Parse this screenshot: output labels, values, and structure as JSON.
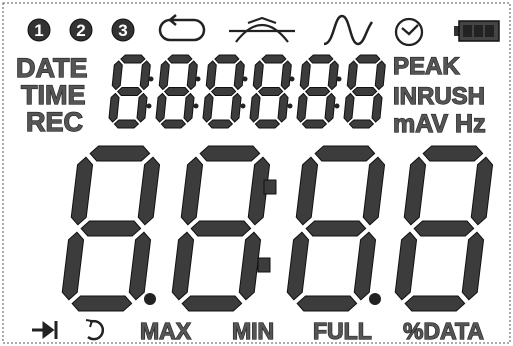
{
  "indicators": {
    "step1": "1",
    "step2": "2",
    "step3": "3",
    "date": "DATE",
    "time": "TIME",
    "rec": "REC",
    "peak": "PEAK",
    "inrush": "INRUSH",
    "units": "mAV Hz",
    "max": "MAX",
    "min": "MIN",
    "full": "FULL",
    "pct_data": "%DATA"
  },
  "icons": [
    "loop-icon",
    "peak-wave-icon",
    "sine-wave-icon",
    "clock-icon",
    "battery-icon",
    "arrow-to-bar-icon",
    "refresh-icon"
  ],
  "small_display_digits": 6,
  "main_display_digits": 4,
  "colors": {
    "segment": "#3c3c3c",
    "outline": "#111111",
    "label": "#555555",
    "background": "#ffffff"
  }
}
